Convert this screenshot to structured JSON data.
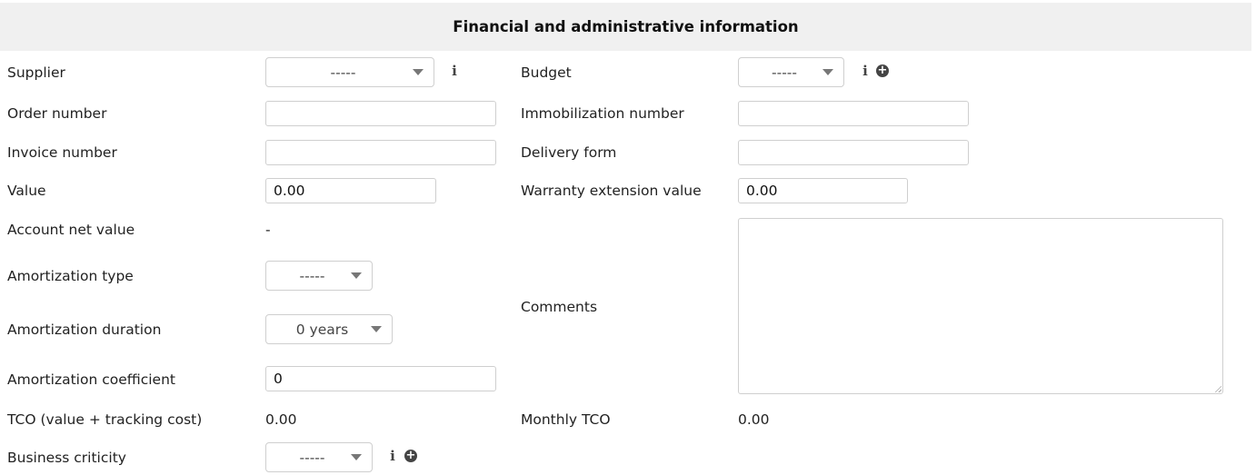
{
  "header": {
    "title": "Financial and administrative information"
  },
  "left": {
    "supplier": {
      "label": "Supplier",
      "value": "-----"
    },
    "order_number": {
      "label": "Order number",
      "value": ""
    },
    "invoice_number": {
      "label": "Invoice number",
      "value": ""
    },
    "value": {
      "label": "Value",
      "value": "0.00"
    },
    "account_net_value": {
      "label": "Account net value",
      "value": "-"
    },
    "amortization_type": {
      "label": "Amortization type",
      "value": "-----"
    },
    "amortization_duration": {
      "label": "Amortization duration",
      "value": "0 years"
    },
    "amortization_coefficient": {
      "label": "Amortization coefficient",
      "value": "0"
    },
    "tco": {
      "label": "TCO (value + tracking cost)",
      "value": "0.00"
    },
    "business_criticity": {
      "label": "Business criticity",
      "value": "-----"
    }
  },
  "right": {
    "budget": {
      "label": "Budget",
      "value": "-----"
    },
    "immobilization_number": {
      "label": "Immobilization number",
      "value": ""
    },
    "delivery_form": {
      "label": "Delivery form",
      "value": ""
    },
    "warranty_extension_value": {
      "label": "Warranty extension value",
      "value": "0.00"
    },
    "comments": {
      "label": "Comments",
      "value": ""
    },
    "monthly_tco": {
      "label": "Monthly TCO",
      "value": "0.00"
    }
  },
  "icons": {
    "info": "i",
    "plus": "+"
  }
}
